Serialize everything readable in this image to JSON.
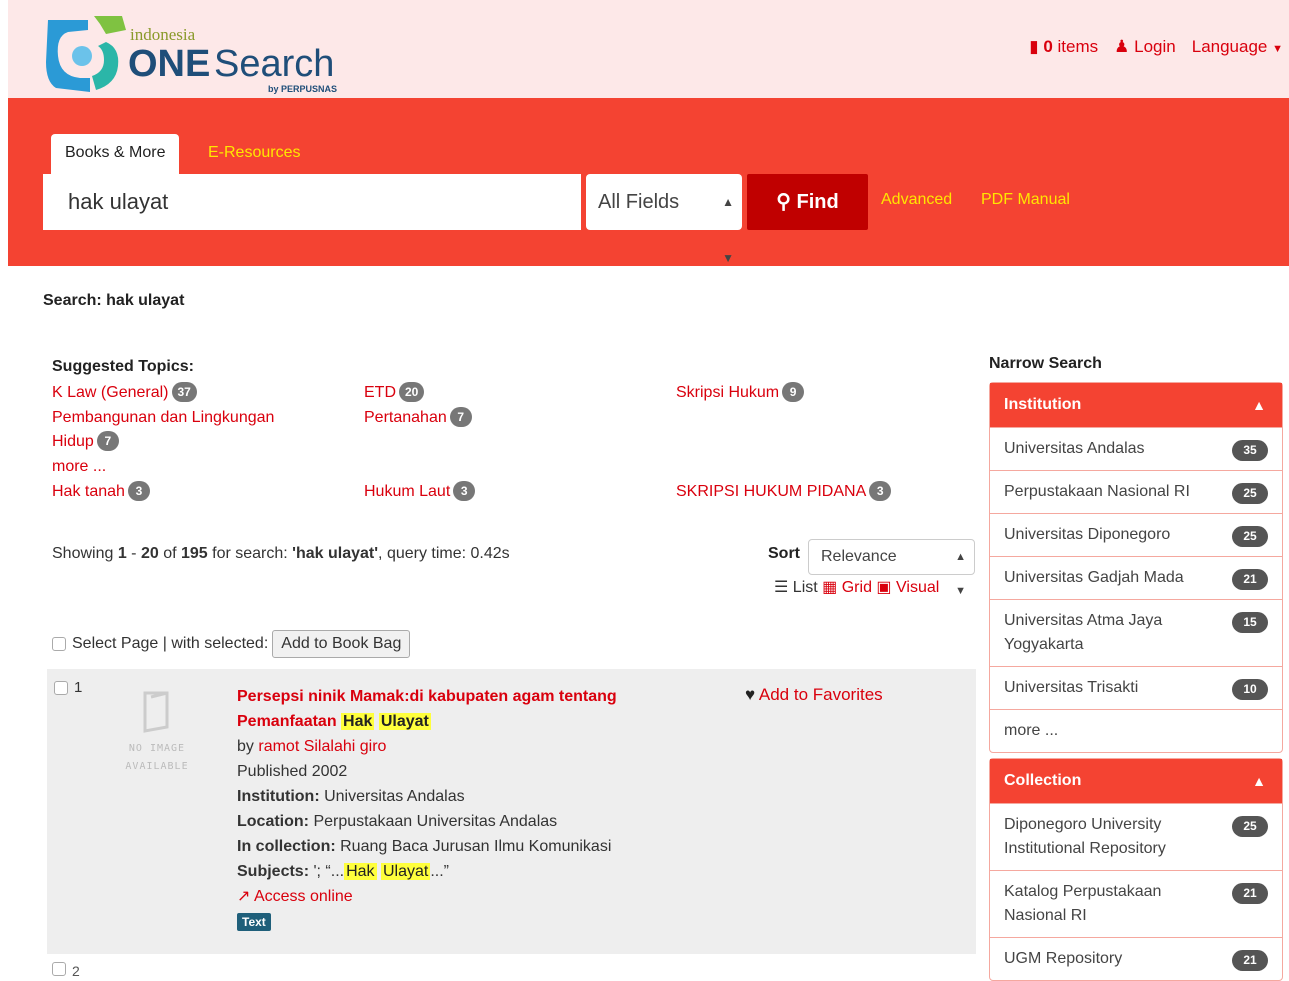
{
  "header": {
    "logo_small": "indonesia",
    "logo_one": "ONE",
    "logo_search": "Search",
    "logo_by": "by PERPUSNAS",
    "items_count": "0",
    "items_label": "items",
    "login": "Login",
    "language": "Language"
  },
  "tabs": [
    "Books & More",
    "E-Resources"
  ],
  "search": {
    "value": "hak ulayat",
    "field": "All Fields",
    "find": "Find",
    "advanced": "Advanced",
    "manual": "PDF Manual"
  },
  "breadcrumb": "Search: hak ulayat",
  "topics": {
    "title": "Suggested Topics:",
    "items": [
      {
        "label": "K Law (General)",
        "count": "37"
      },
      {
        "label": "ETD",
        "count": "20"
      },
      {
        "label": "Skripsi Hukum",
        "count": "9"
      },
      {
        "label": "Pembangunan dan Lingkungan Hidup",
        "count": "7"
      },
      {
        "label": "Pertanahan",
        "count": "7"
      },
      {
        "label": "Hak tanah",
        "count": "3"
      },
      {
        "label": "Hukum Laut",
        "count": "3"
      },
      {
        "label": "SKRIPSI HUKUM PIDANA",
        "count": "3"
      }
    ],
    "more": "more ..."
  },
  "results_info": {
    "prefix": "Showing ",
    "start": "1",
    "dash": " - ",
    "end": "20",
    "of": " of ",
    "total": "195",
    "for": " for search: ",
    "query": "'hak ulayat'",
    "time": ", query time: 0.42s"
  },
  "sort": {
    "label": "Sort",
    "value": "Relevance"
  },
  "views": {
    "list": "List",
    "grid": "Grid",
    "visual": "Visual"
  },
  "select_page": {
    "label": "Select Page | with selected:",
    "button": "Add to Book Bag"
  },
  "result1": {
    "num": "1",
    "noimage_1": "NO IMAGE",
    "noimage_2": "AVAILABLE",
    "title_a": "Persepsi ninik Mamak:di kabupaten agam tentang Pemanfaatan",
    "hl1": "Hak",
    "hl2": "Ulayat",
    "by": "by",
    "author": "ramot Silalahi giro",
    "published": "Published 2002",
    "inst_label": "Institution:",
    "inst": "Universitas Andalas",
    "loc_label": "Location:",
    "loc": "Perpustakaan Universitas Andalas",
    "coll_label": "In collection:",
    "coll": "Ruang Baca Jurusan Ilmu Komunikasi",
    "subj_label": "Subjects:",
    "subj_pre": "'; “...",
    "subj_post": "...”",
    "access": "Access online",
    "format": "Text",
    "favorite": "Add to Favorites"
  },
  "result2_num": "2",
  "narrow": {
    "title": "Narrow Search",
    "institution": {
      "head": "Institution",
      "items": [
        {
          "label": "Universitas Andalas",
          "count": "35"
        },
        {
          "label": "Perpustakaan Nasional RI",
          "count": "25"
        },
        {
          "label": "Universitas Diponegoro",
          "count": "25"
        },
        {
          "label": "Universitas Gadjah Mada",
          "count": "21"
        },
        {
          "label": "Universitas Atma Jaya Yogyakarta",
          "count": "15"
        },
        {
          "label": "Universitas Trisakti",
          "count": "10"
        }
      ],
      "more": "more ..."
    },
    "collection": {
      "head": "Collection",
      "items": [
        {
          "label": "Diponegoro University Institutional Repository",
          "count": "25"
        },
        {
          "label": "Katalog Perpustakaan Nasional RI",
          "count": "21"
        },
        {
          "label": "UGM Repository",
          "count": "21"
        }
      ]
    }
  }
}
